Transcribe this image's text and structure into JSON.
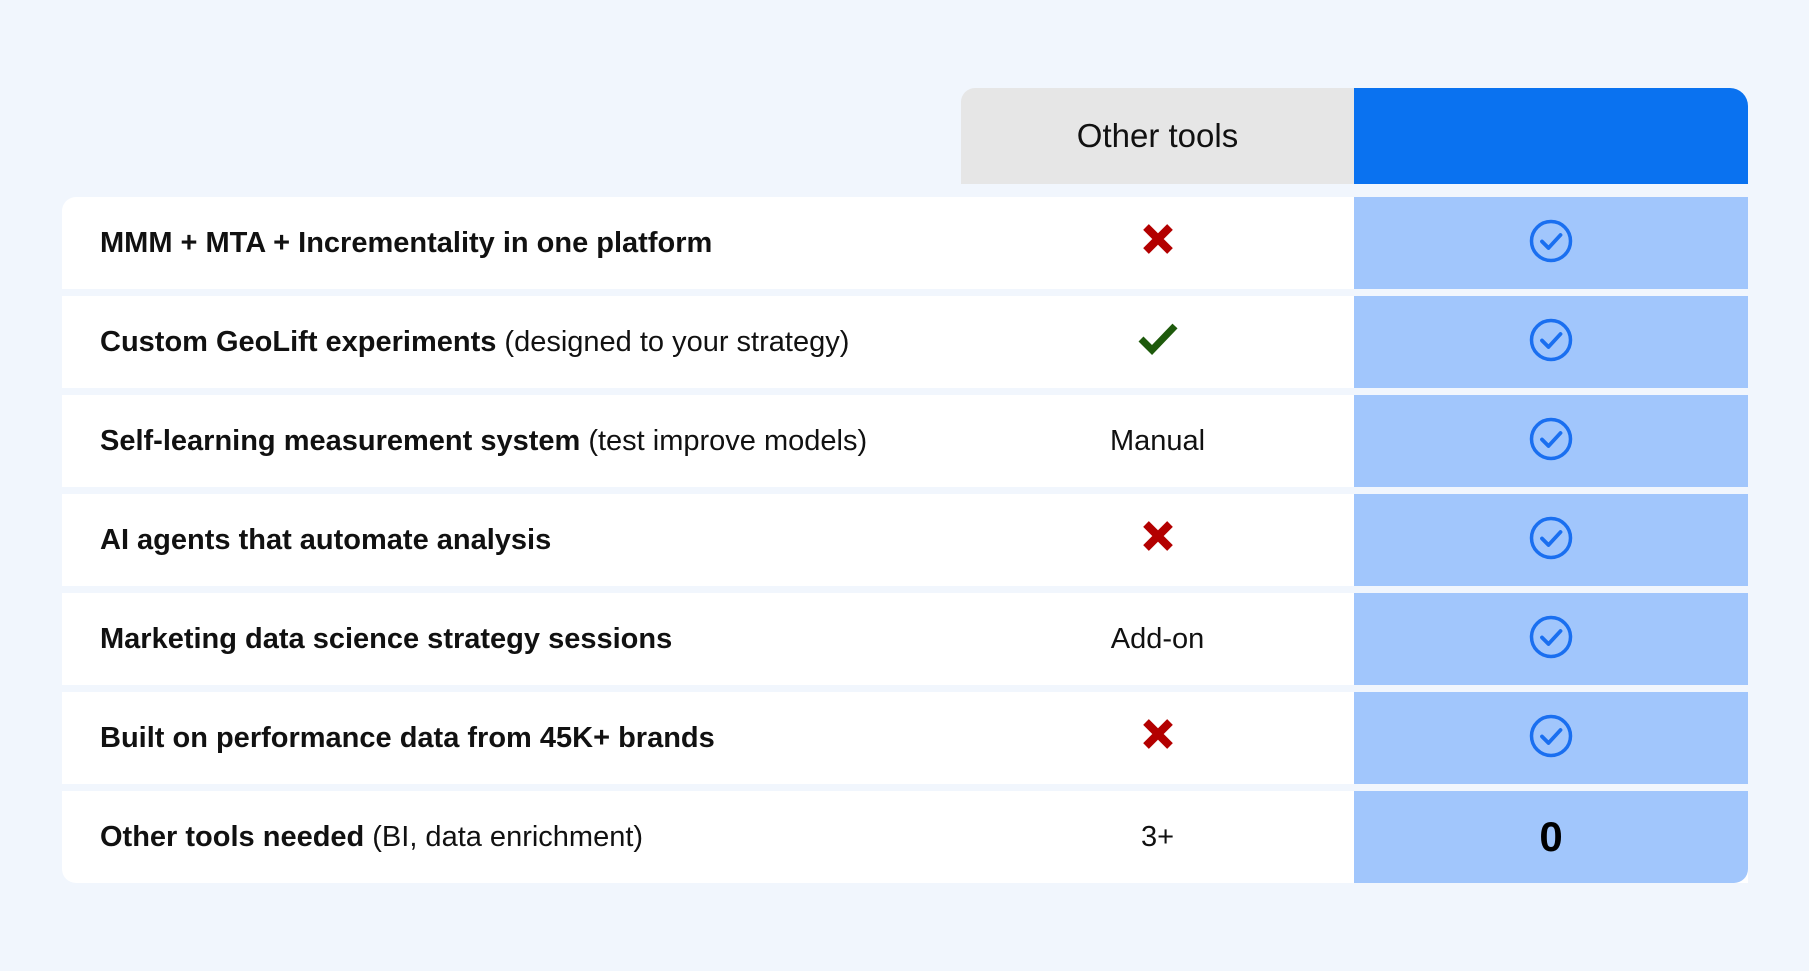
{
  "header": {
    "other_tools": "Other tools"
  },
  "colors": {
    "page_background": "#f1f6fd",
    "brand_header": "#0a72f0",
    "brand_cell": "#a1c6fc",
    "check_circle": "#1a6ff0",
    "cross": "#b30000",
    "green_check": "#1e5a0c"
  },
  "rows": [
    {
      "feature": "MMM + MTA + Incrementality in one platform",
      "note": "",
      "other": {
        "type": "icon",
        "icon": "cross-icon"
      },
      "brand": {
        "type": "icon",
        "icon": "check-circle-icon"
      }
    },
    {
      "feature": "Custom GeoLift experiments",
      "note": "(designed to your strategy)",
      "other": {
        "type": "icon",
        "icon": "checkmark-icon"
      },
      "brand": {
        "type": "icon",
        "icon": "check-circle-icon"
      }
    },
    {
      "feature": "Self-learning measurement system",
      "note": "(test improve models)",
      "other": {
        "type": "text",
        "text": "Manual"
      },
      "brand": {
        "type": "icon",
        "icon": "check-circle-icon"
      }
    },
    {
      "feature": "AI agents that automate analysis",
      "note": "",
      "other": {
        "type": "icon",
        "icon": "cross-icon"
      },
      "brand": {
        "type": "icon",
        "icon": "check-circle-icon"
      }
    },
    {
      "feature": "Marketing data science strategy sessions",
      "note": "",
      "other": {
        "type": "text",
        "text": "Add-on"
      },
      "brand": {
        "type": "icon",
        "icon": "check-circle-icon"
      }
    },
    {
      "feature": "Built on performance data from 45K+ brands",
      "note": "",
      "other": {
        "type": "icon",
        "icon": "cross-icon"
      },
      "brand": {
        "type": "icon",
        "icon": "check-circle-icon"
      }
    },
    {
      "feature": "Other tools needed",
      "note": "(BI, data enrichment)",
      "other": {
        "type": "text",
        "text": "3+"
      },
      "brand": {
        "type": "text",
        "text": "0"
      }
    }
  ]
}
